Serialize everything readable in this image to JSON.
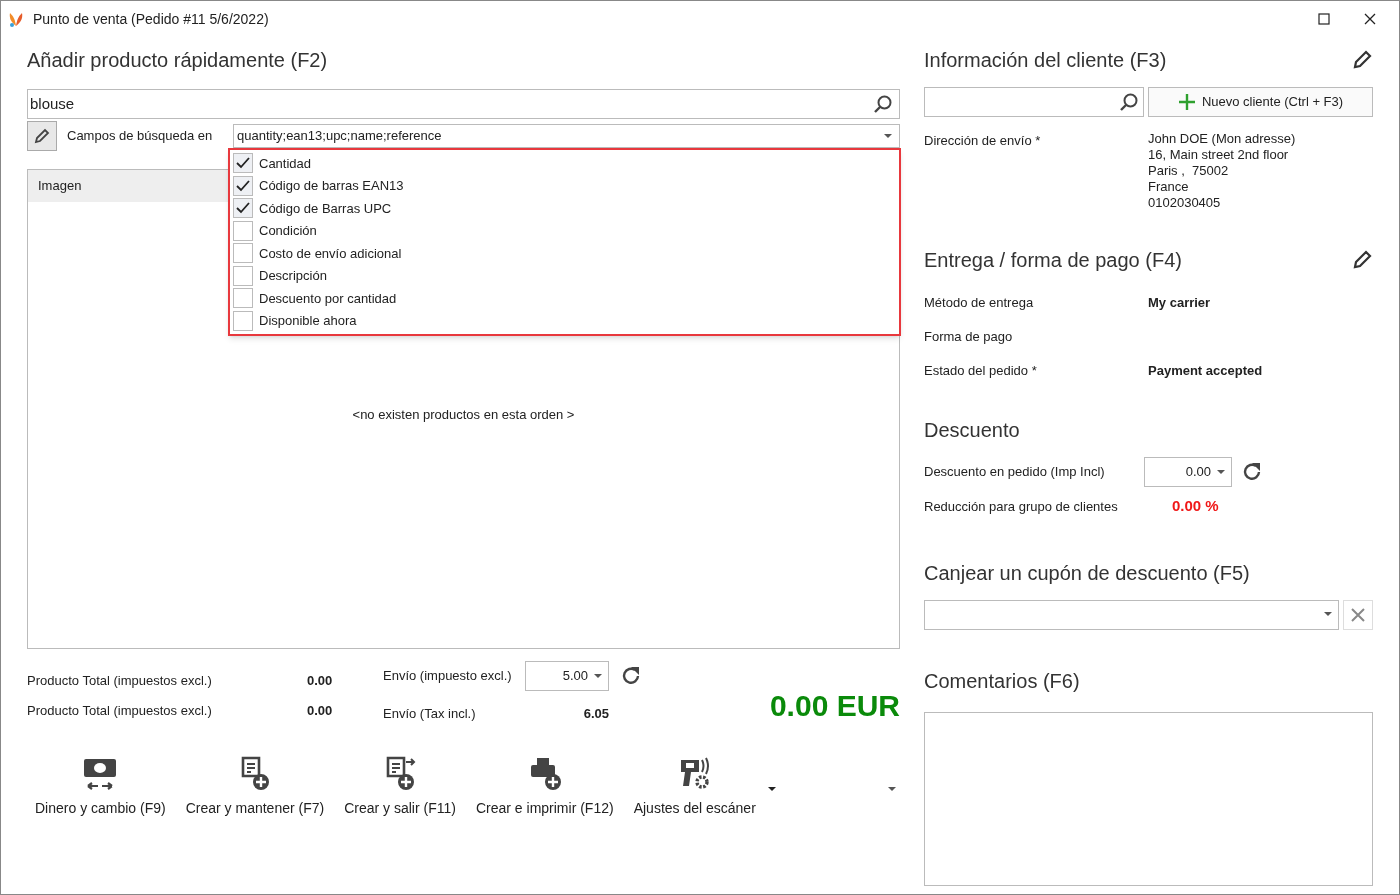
{
  "window": {
    "title": "Punto de venta (Pedido #11 5/6/2022)"
  },
  "quick_add": {
    "title": "Añadir producto rápidamente (F2)",
    "search_value": "blouse",
    "fields_label": "Campos de búsqueda en",
    "fields_value": "quantity;ean13;upc;name;reference",
    "options": [
      {
        "label": "Cantidad",
        "checked": true
      },
      {
        "label": "Código de barras EAN13",
        "checked": true
      },
      {
        "label": "Código de Barras UPC",
        "checked": true
      },
      {
        "label": "Condición",
        "checked": false
      },
      {
        "label": "Costo de envío adicional",
        "checked": false
      },
      {
        "label": "Descripción",
        "checked": false
      },
      {
        "label": "Descuento por cantidad",
        "checked": false
      },
      {
        "label": "Disponible ahora",
        "checked": false
      }
    ],
    "table": {
      "columns": [
        "Imagen"
      ],
      "empty_message": "<no existen productos en esta orden >"
    }
  },
  "totals": {
    "rows": [
      {
        "label": "Producto Total (impuestos excl.)",
        "value": "0.00"
      },
      {
        "label": "Producto Total (impuestos excl.)",
        "value": "0.00"
      }
    ],
    "shipping": [
      {
        "label": "Envío (impuesto excl.)",
        "value": "5.00",
        "kind": "dropdown"
      },
      {
        "label": "Envío (Tax incl.)",
        "value": "6.05",
        "kind": "text"
      }
    ],
    "grand_total": "0.00 EUR"
  },
  "actions": [
    {
      "label": "Dinero y cambio (F9)",
      "kind": "money"
    },
    {
      "label": "Crear y mantener (F7)",
      "kind": "keep"
    },
    {
      "label": "Crear y salir (F11)",
      "kind": "exit"
    },
    {
      "label": "Crear e imprimir (F12)",
      "kind": "print"
    },
    {
      "label": "Ajustes del escáner",
      "kind": "scanner"
    }
  ],
  "customer": {
    "title": "Información del cliente (F3)",
    "new_button": "Nuevo cliente (Ctrl + F3)",
    "address_label": "Dirección de envío *",
    "address_lines": [
      "John DOE (Mon adresse)",
      "16, Main street 2nd floor",
      "Paris ,  75002",
      "France",
      "0102030405"
    ]
  },
  "delivery": {
    "title": "Entrega / forma de pago (F4)",
    "rows": [
      {
        "label": "Método de entrega",
        "value": "My carrier"
      },
      {
        "label": "Forma de pago"
      },
      {
        "label": "Estado del pedido *",
        "value": "Payment accepted"
      }
    ]
  },
  "discount": {
    "title": "Descuento",
    "order_label": "Descuento en pedido (Imp Incl)",
    "order_value": "0.00",
    "group_label": "Reducción para grupo de clientes",
    "group_value": "0.00 %"
  },
  "coupon": {
    "title": "Canjear un cupón de descuento (F5)"
  },
  "comments": {
    "title": "Comentarios (F6)"
  }
}
